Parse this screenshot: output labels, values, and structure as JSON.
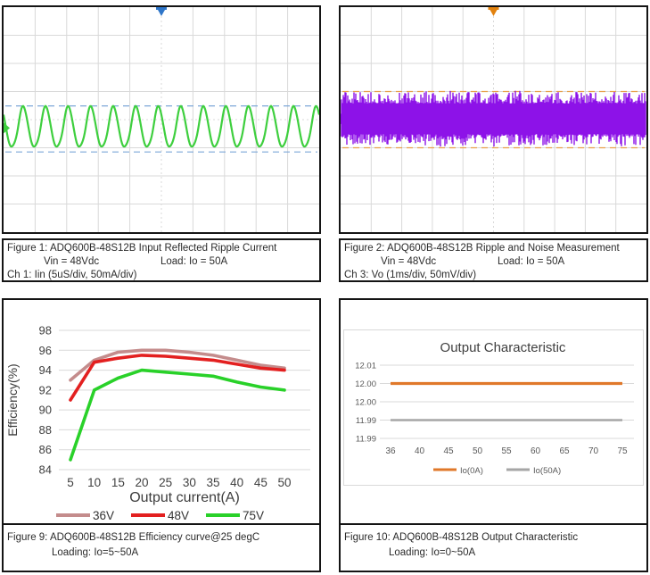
{
  "captions": {
    "fig1": {
      "title": "Figure 1: ADQ600B-48S12B Input Reflected Ripple Current",
      "vin": "Vin = 48Vdc",
      "load": "Load: Io = 50A",
      "channel": "Ch 1: Iin (5uS/div, 50mA/div)"
    },
    "fig2": {
      "title": "Figure 2: ADQ600B-48S12B Ripple and Noise Measurement",
      "vin": "Vin = 48Vdc",
      "load": "Load: Io = 50A",
      "channel": "Ch 3: Vo (1ms/div, 50mV/div)"
    },
    "fig9": {
      "title": "Figure 9: ADQ600B-48S12B Efficiency curve@25 degC",
      "loading": "Loading: Io=5~50A"
    },
    "fig10": {
      "title": "Figure 10: ADQ600B-48S12B Output Characteristic",
      "loading": "Loading: Io=0~50A"
    }
  },
  "colors": {
    "scope_grid": "#d9d9d9",
    "chart_grid": "#d9d9d9",
    "axis_text": "#404040",
    "small_axis_text": "#595959",
    "caption_text": "#2b2b2b"
  },
  "chart_data": [
    {
      "id": "fig1_scope",
      "type": "line",
      "subtype": "oscilloscope",
      "channel_label": "Ch 1: Iin",
      "time_per_div": "5uS",
      "scale_per_div": "50mA",
      "divisions": {
        "x": 10,
        "y": 8
      },
      "trace": {
        "shape": "sine",
        "cycles": 14,
        "center_div": 4.3,
        "amplitude_div": 0.72,
        "color": "#3ecf3e"
      },
      "cursors": {
        "divs": [
          3.51,
          5.15
        ],
        "color": "#7da7d8",
        "style": "dashed"
      },
      "trigger": {
        "pos_div": 5,
        "color": "#2e75c8"
      },
      "grid_color": "#d9d9d9"
    },
    {
      "id": "fig2_scope",
      "type": "line",
      "subtype": "oscilloscope",
      "channel_label": "Ch 3: Vo",
      "time_per_div": "1ms",
      "scale_per_div": "50mV",
      "divisions": {
        "x": 10,
        "y": 8
      },
      "trace": {
        "shape": "noise",
        "center_div": 3.97,
        "core_amplitude_div": 0.55,
        "spike_amplitude_div": 0.95,
        "color": "#8d12e8"
      },
      "cursors": {
        "divs": [
          3.0,
          5.0
        ],
        "color": "#e8a04a",
        "style": "dashed"
      },
      "trigger": {
        "pos_div": 5,
        "color": "#e2820e"
      },
      "grid_color": "#d9d9d9"
    },
    {
      "id": "fig9_efficiency",
      "type": "line",
      "title": "",
      "xlabel": "Output current(A)",
      "ylabel": "Efficiency(%)",
      "x": [
        5,
        10,
        15,
        20,
        25,
        30,
        35,
        40,
        45,
        50
      ],
      "ylim": [
        84,
        98
      ],
      "ytick_step": 2,
      "grid": "horizontal",
      "legend_position": "bottom",
      "series": [
        {
          "name": "36V",
          "color": "#c48c8c",
          "values": [
            93,
            95,
            95.8,
            96,
            96,
            95.8,
            95.5,
            95,
            94.5,
            94.2
          ]
        },
        {
          "name": "48V",
          "color": "#e32020",
          "values": [
            91,
            94.8,
            95.2,
            95.5,
            95.4,
            95.2,
            95,
            94.6,
            94.2,
            94
          ]
        },
        {
          "name": "75V",
          "color": "#29d129",
          "values": [
            85,
            92,
            93.2,
            94,
            93.8,
            93.6,
            93.4,
            92.8,
            92.3,
            92
          ]
        }
      ]
    },
    {
      "id": "fig10_output",
      "type": "line",
      "title": "Output Characteristic",
      "x": [
        36,
        40,
        45,
        50,
        55,
        60,
        65,
        70,
        75
      ],
      "ytick_labels": [
        "12.01",
        "12.00",
        "12.00",
        "11.99",
        "11.99"
      ],
      "grid": "horizontal",
      "legend_position": "bottom",
      "series": [
        {
          "name": "Io(0A)",
          "color": "#e0782a",
          "value": 12.0,
          "gridline_index": 1
        },
        {
          "name": "Io(50A)",
          "color": "#a6a6a6",
          "value": 11.99,
          "gridline_index": 3
        }
      ]
    }
  ]
}
